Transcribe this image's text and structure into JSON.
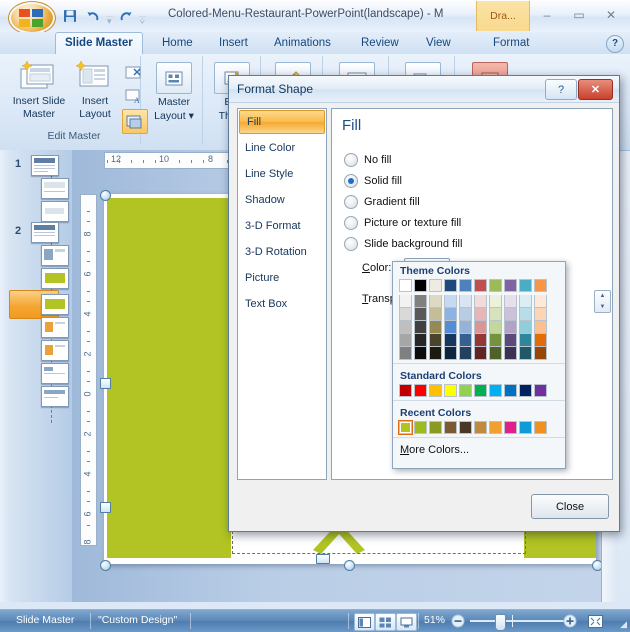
{
  "window": {
    "title": "Colored-Menu-Restaurant-PowerPoint(landscape) - M",
    "contextual_tab": "Dra...",
    "minimize": "–",
    "maximize": "▭",
    "close": "✕",
    "help": "?"
  },
  "quick_access": {
    "save_icon": "save-icon",
    "undo_icon": "undo-icon",
    "redo_icon": "redo-icon",
    "customize_icon": "chevron-down-icon"
  },
  "ribbon": {
    "tabs": [
      {
        "label": "Slide Master",
        "active": true
      },
      {
        "label": "Home",
        "active": false
      },
      {
        "label": "Insert",
        "active": false
      },
      {
        "label": "Animations",
        "active": false
      },
      {
        "label": "Review",
        "active": false
      },
      {
        "label": "View",
        "active": false
      },
      {
        "label": "Format",
        "active": false
      }
    ],
    "groups": [
      {
        "name": "Edit Master",
        "buttons": [
          {
            "label": "Insert Slide Master"
          },
          {
            "label": "Insert Layout"
          },
          {
            "label": "Master Layout"
          },
          {
            "label": "Edit Theme"
          }
        ]
      }
    ],
    "group_edit_master_label": "Edit Master",
    "btn_insert_slide_master": "Insert Slide\nMaster",
    "btn_insert_slide_master_l1": "Insert Slide",
    "btn_insert_slide_master_l2": "Master",
    "btn_insert_layout_l1": "Insert",
    "btn_insert_layout_l2": "Layout",
    "btn_master_layout_l1": "Master",
    "btn_master_layout_l2": "Layout ▾",
    "btn_edit_theme_l1": "Edi",
    "btn_edit_theme_l2": "Them"
  },
  "thumbnails": {
    "group_numbers": [
      "1",
      "2"
    ],
    "selected_index": 7
  },
  "ruler": {
    "horizontal_labels": [
      "12",
      "10",
      "8"
    ],
    "vertical_labels": [
      "8",
      "6",
      "4",
      "2",
      "0",
      "2",
      "4",
      "6",
      "8"
    ]
  },
  "dialog": {
    "title": "Format Shape",
    "help_label": "?",
    "close_label": "✕",
    "nav": [
      {
        "label": "Fill",
        "selected": true
      },
      {
        "label": "Line Color",
        "selected": false
      },
      {
        "label": "Line Style",
        "selected": false
      },
      {
        "label": "Shadow",
        "selected": false
      },
      {
        "label": "3-D Format",
        "selected": false
      },
      {
        "label": "3-D Rotation",
        "selected": false
      },
      {
        "label": "Picture",
        "selected": false
      },
      {
        "label": "Text Box",
        "selected": false
      }
    ],
    "pane_title": "Fill",
    "radios": [
      {
        "label_pre": "",
        "label_u": "N",
        "label_post": "o fill",
        "checked": false,
        "full": "No fill"
      },
      {
        "label_pre": "",
        "label_u": "S",
        "label_post": "olid fill",
        "checked": true,
        "full": "Solid fill"
      },
      {
        "label_pre": "",
        "label_u": "G",
        "label_post": "radient fill",
        "checked": false,
        "full": "Gradient fill"
      },
      {
        "label_pre": "",
        "label_u": "P",
        "label_post": "icture or texture fill",
        "checked": false,
        "full": "Picture or texture fill"
      },
      {
        "label_pre": "Slide ",
        "label_u": "b",
        "label_post": "ackground fill",
        "checked": false,
        "full": "Slide background fill"
      }
    ],
    "color_label_u": "C",
    "color_label_rest": "olor:",
    "transparency_label_u": "T",
    "transparency_label_rest": "ranspa",
    "close_button": "Close"
  },
  "color_dropdown": {
    "theme_header": "Theme Colors",
    "standard_header": "Standard Colors",
    "recent_header": "Recent Colors",
    "more_colors_u": "M",
    "more_colors_rest": "ore Colors...",
    "theme_base": [
      "#ffffff",
      "#000000",
      "#eeece1",
      "#1f497d",
      "#4f81bd",
      "#c0504d",
      "#9bbb59",
      "#8064a2",
      "#4bacc6",
      "#f79646"
    ],
    "theme_variants": [
      [
        "#f2f2f2",
        "#d9d9d9",
        "#bfbfbf",
        "#a6a6a6",
        "#808080"
      ],
      [
        "#808080",
        "#595959",
        "#404040",
        "#262626",
        "#0c0c0c"
      ],
      [
        "#ddd9c3",
        "#c4bd97",
        "#948a54",
        "#4a452a",
        "#1d1b10"
      ],
      [
        "#c6d9f0",
        "#8db3e2",
        "#548dd4",
        "#17365d",
        "#0f243e"
      ],
      [
        "#dbe5f1",
        "#b8cce4",
        "#95b3d7",
        "#366092",
        "#244061"
      ],
      [
        "#f2dcdb",
        "#e5b8b7",
        "#d99694",
        "#953734",
        "#632423"
      ],
      [
        "#ebf1dd",
        "#d7e3bc",
        "#c3d69b",
        "#76923c",
        "#4f6128"
      ],
      [
        "#e5e0ec",
        "#ccc1d9",
        "#b2a2c7",
        "#5f497a",
        "#3f3151"
      ],
      [
        "#daeef3",
        "#b7dde8",
        "#92cddc",
        "#31859b",
        "#205867"
      ],
      [
        "#fde9d9",
        "#fbd5b5",
        "#fac08f",
        "#e36c09",
        "#974806"
      ]
    ],
    "standard": [
      "#c00000",
      "#ff0000",
      "#ffc000",
      "#ffff00",
      "#92d050",
      "#00b050",
      "#00b0f0",
      "#0070c0",
      "#002060",
      "#7030a0"
    ],
    "recent": [
      "#b2c423",
      "#9bbb1e",
      "#8a9a20",
      "#7b5a32",
      "#4a3726",
      "#c08a3e",
      "#f0a030",
      "#e0218a",
      "#0f9bd7",
      "#f09020"
    ],
    "recent_selected_index": 0,
    "spinner_up": "▲",
    "spinner_down": "▼"
  },
  "slide": {
    "shape_fill": "#b2c423"
  },
  "status_bar": {
    "view_name": "Slide Master",
    "theme_name": "\"Custom Design\"",
    "zoom_percent": "51%",
    "zoom_out": "−",
    "zoom_in": "+",
    "view_buttons": [
      "normal-view",
      "slide-sorter-view",
      "slide-show-view"
    ],
    "fit_button": "fit-to-window"
  }
}
